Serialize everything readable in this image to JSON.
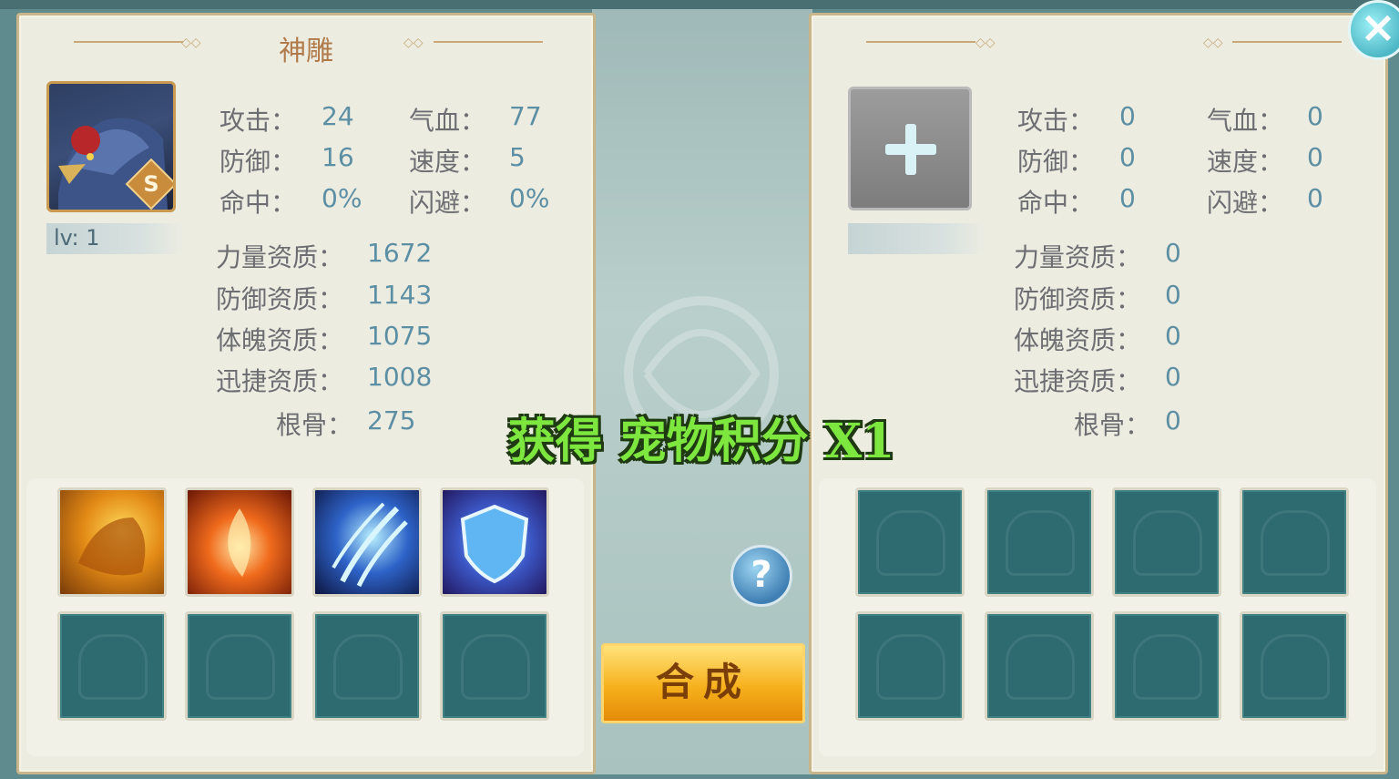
{
  "left_pet": {
    "name": "神雕",
    "rank": "S",
    "level": "lv: 1",
    "stats": [
      {
        "label": "攻击：",
        "value": "24"
      },
      {
        "label": "气血：",
        "value": "77"
      },
      {
        "label": "防御：",
        "value": "16"
      },
      {
        "label": "速度：",
        "value": "5"
      },
      {
        "label": "命中：",
        "value": "0%"
      },
      {
        "label": "闪避：",
        "value": "0%"
      }
    ],
    "aptitudes": [
      {
        "label": "力量资质：",
        "value": "1672"
      },
      {
        "label": "防御资质：",
        "value": "1143"
      },
      {
        "label": "体魄资质：",
        "value": "1075"
      },
      {
        "label": "迅捷资质：",
        "value": "1008"
      },
      {
        "label": "根骨：",
        "value": "275"
      }
    ],
    "skills": [
      "beast-roar-icon",
      "phoenix-fire-icon",
      "claw-slash-icon",
      "shield-icon"
    ]
  },
  "right_pet": {
    "stats": [
      {
        "label": "攻击：",
        "value": "0"
      },
      {
        "label": "气血：",
        "value": "0"
      },
      {
        "label": "防御：",
        "value": "0"
      },
      {
        "label": "速度：",
        "value": "0"
      },
      {
        "label": "命中：",
        "value": "0"
      },
      {
        "label": "闪避：",
        "value": "0"
      }
    ],
    "aptitudes": [
      {
        "label": "力量资质：",
        "value": "0"
      },
      {
        "label": "防御资质：",
        "value": "0"
      },
      {
        "label": "体魄资质：",
        "value": "0"
      },
      {
        "label": "迅捷资质：",
        "value": "0"
      },
      {
        "label": "根骨：",
        "value": "0"
      }
    ]
  },
  "center": {
    "help": "?",
    "compose_label": "合成",
    "notice": "获得 宠物积分 X1"
  },
  "close": "×",
  "colors": {
    "label": "#6d6e72",
    "value": "#5d8fa4",
    "notice": "#7de63f",
    "button": "#f6b11c"
  }
}
